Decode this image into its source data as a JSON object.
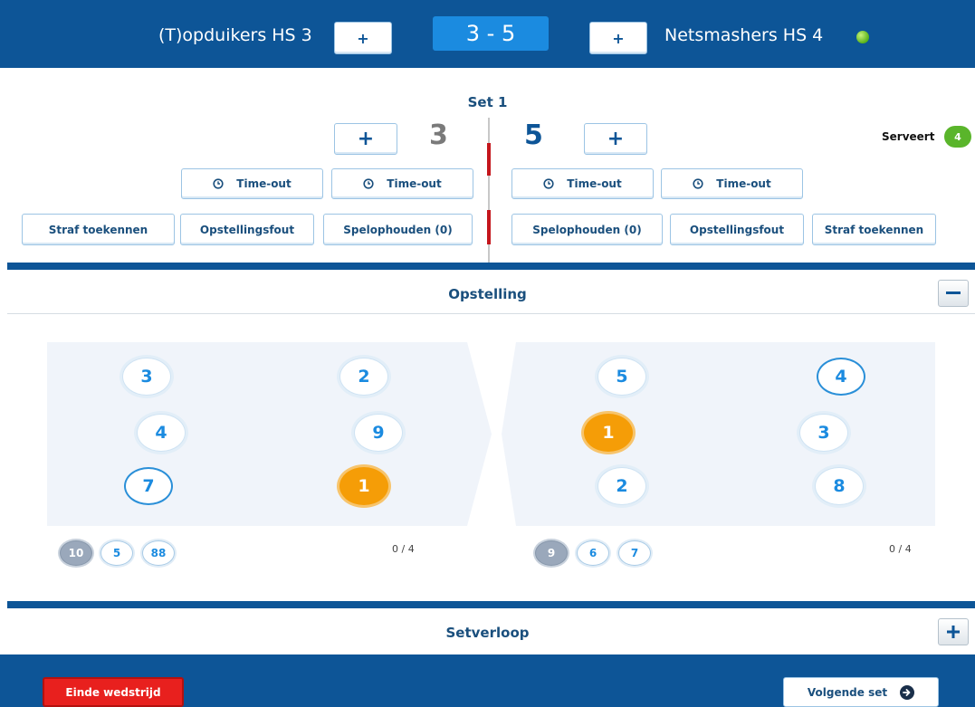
{
  "header": {
    "home_team": "(T)opduikers HS 3",
    "away_team": "Netsmashers HS 4",
    "match_score": "3 - 5",
    "add_label": "+"
  },
  "set": {
    "title": "Set 1",
    "home_score": "3",
    "away_score": "5",
    "add_label": "+",
    "serve_label": "Serveert",
    "server_number": "4",
    "timeout_label": "Time-out",
    "home_buttons": [
      "Straf toekennen",
      "Opstellingsfout",
      "Spelophouden (0)"
    ],
    "away_buttons": [
      "Spelophouden (0)",
      "Opstellingsfout",
      "Straf toekennen"
    ]
  },
  "lineup": {
    "title": "Opstelling",
    "collapse_label": "−",
    "home_players": [
      "3",
      "2",
      "4",
      "9",
      "7",
      "1"
    ],
    "away_players": [
      "5",
      "4",
      "1",
      "3",
      "2",
      "8"
    ],
    "home_bench": [
      "10",
      "5",
      "88"
    ],
    "away_bench": [
      "9",
      "6",
      "7"
    ],
    "home_substitutions": "0 / 4",
    "away_substitutions": "0 / 4"
  },
  "set_progress": {
    "title": "Setverloop",
    "expand_label": "+"
  },
  "footer": {
    "end_match": "Einde wedstrijd",
    "next_set": "Volgende set"
  },
  "colors": {
    "primary": "#0d5597",
    "accent": "#1b8be0",
    "server": "#f59d07",
    "serve_badge": "#5ab52b",
    "danger": "#e8201e"
  }
}
